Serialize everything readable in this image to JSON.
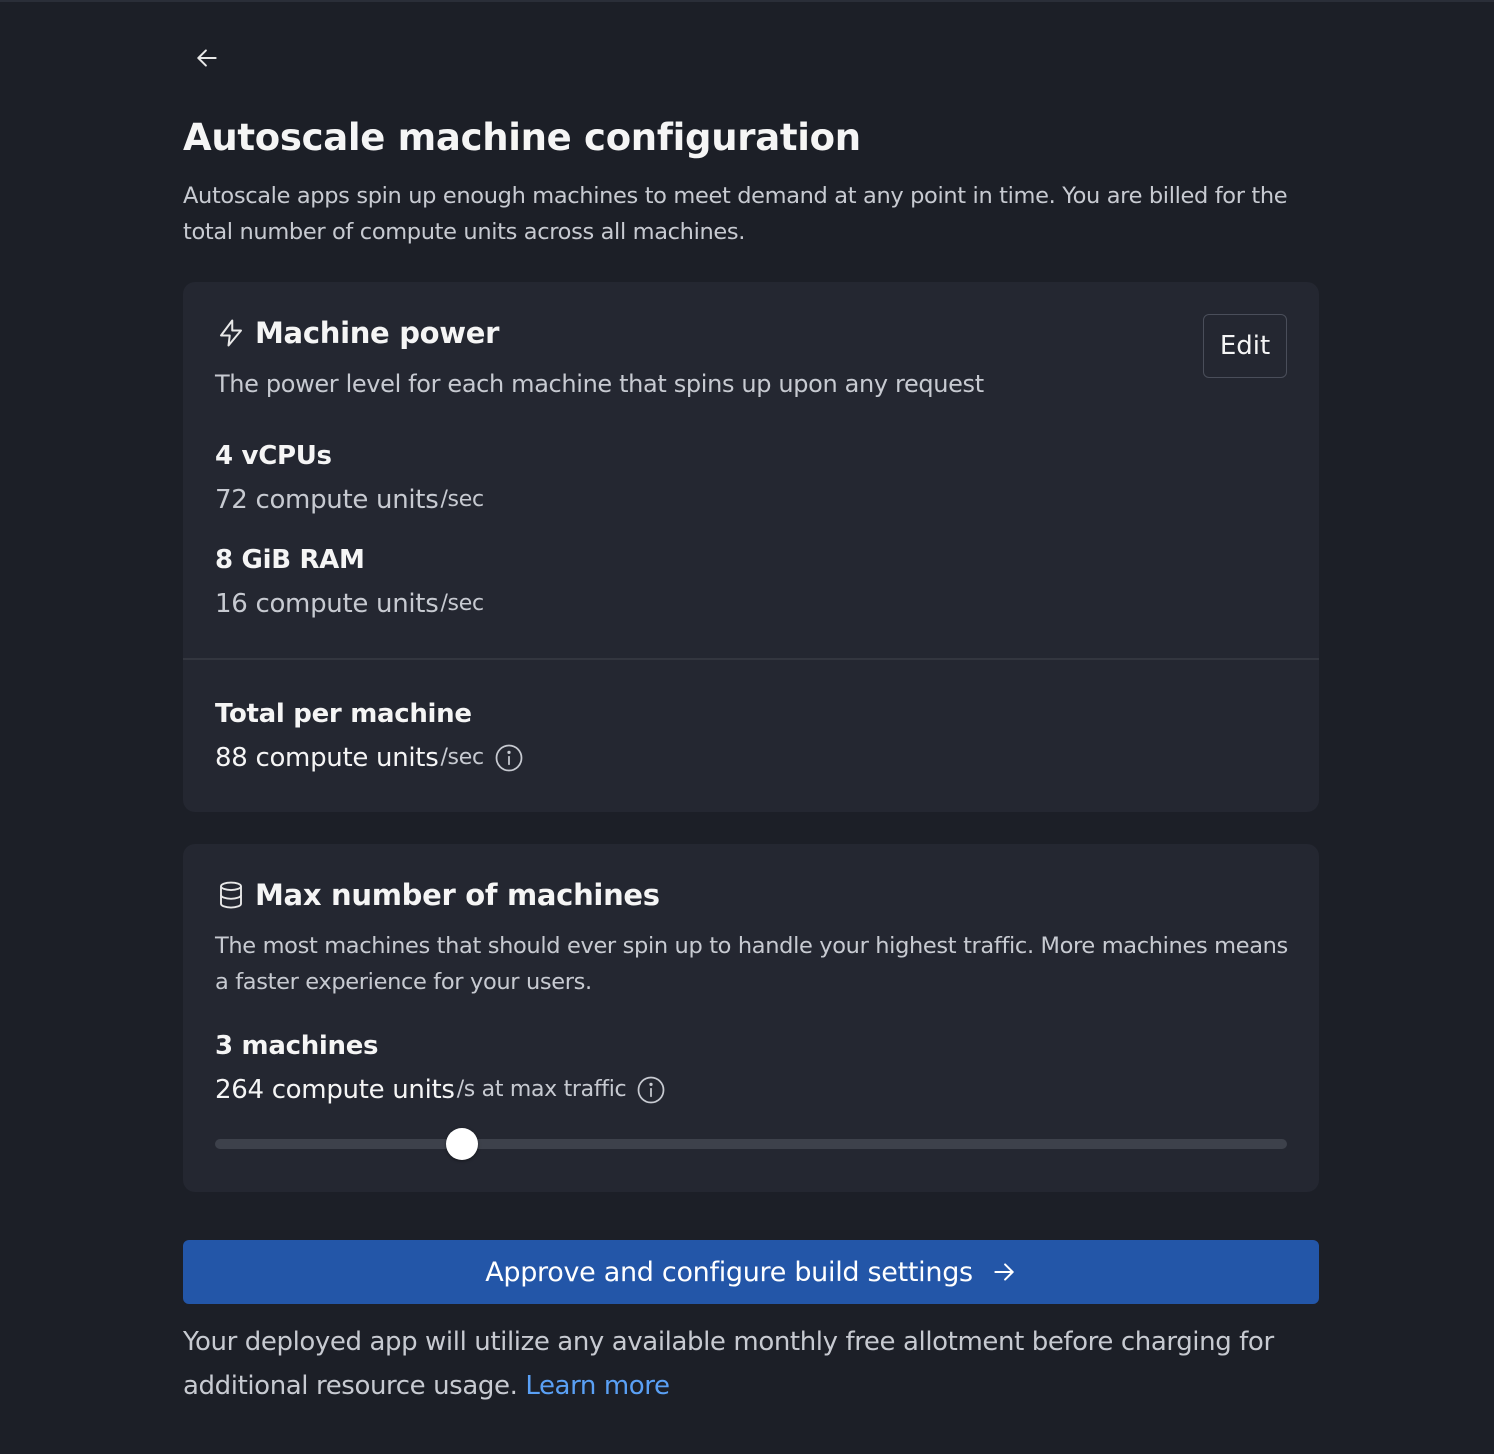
{
  "page": {
    "title": "Autoscale machine configuration",
    "subtitle": "Autoscale apps spin up enough machines to meet demand at any point in time. You are billed for the total number of compute units across all machines."
  },
  "machine_power": {
    "heading": "Machine power",
    "description": "The power level for each machine that spins up upon any request",
    "edit_label": "Edit",
    "cpu": {
      "label": "4 vCPUs",
      "value": "72 compute units",
      "unit": "/sec"
    },
    "ram": {
      "label": "8 GiB RAM",
      "value": "16 compute units",
      "unit": "/sec"
    },
    "total": {
      "label": "Total per machine",
      "value": "88 compute units",
      "unit": "/sec"
    }
  },
  "max_machines": {
    "heading": "Max number of machines",
    "description": "The most machines that should ever spin up to handle your highest traffic. More machines means a faster experience for your users.",
    "count_label": "3 machines",
    "value": "264 compute units",
    "unit": "/s at max traffic",
    "slider_fraction": 0.23
  },
  "approve_button": {
    "label": "Approve and configure build settings"
  },
  "footer": {
    "text": "Your deployed app will utilize any available monthly free allotment before charging for additional resource usage.",
    "link": "Learn more"
  },
  "icons": {
    "back": "arrow-left-icon",
    "power": "lightning-icon",
    "machines": "database-icon",
    "info": "info-icon",
    "approve": "arrow-right-icon"
  },
  "colors": {
    "background": "#1c1f27",
    "card": "#242731",
    "accent_button": "#2356a8",
    "link": "#5aa0f5"
  }
}
